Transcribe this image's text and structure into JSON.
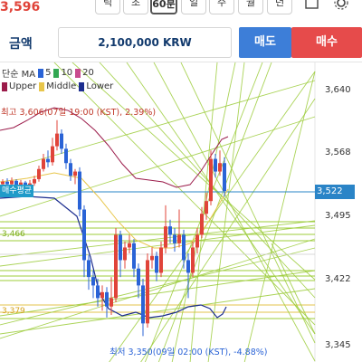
{
  "header": {
    "price_top": "3,596",
    "timeframes": [
      "틱",
      "초",
      "60분",
      "일",
      "주",
      "월",
      "년"
    ],
    "active_timeframe": "60분"
  },
  "order": {
    "asset": "금액",
    "amount": "2,100,000 KRW",
    "sell_label": "매도",
    "buy_label": "매수"
  },
  "legend": {
    "ma_prefix": "단순 MA",
    "ma_periods": [
      "5",
      "10",
      "20"
    ],
    "bb_items": [
      "Upper",
      "Middle",
      "Lower"
    ]
  },
  "axis": {
    "ticks": [
      "3,640",
      "3,568",
      "3,495",
      "3,422",
      "3,345"
    ],
    "current_price": "3,522"
  },
  "annotations": {
    "high": "최고 3,606(07일 19:00 (KST), 2.39%)",
    "low": "최저 3,350(09일 02:00 (KST), -4.88%)",
    "avg_buy": "매수평균",
    "level_466": "3,466",
    "level_379": "3,379"
  },
  "colors": {
    "up": "#e0443a",
    "down": "#2a63d6",
    "ma5": "#2a63d6",
    "ma10": "#33a853",
    "ma20": "#c94b8e",
    "upper": "#9b1b4a",
    "middle": "#e8c64b",
    "lower": "#1c2d8f",
    "trend": "#9ccc3a",
    "accent": "#2a84c7"
  }
}
